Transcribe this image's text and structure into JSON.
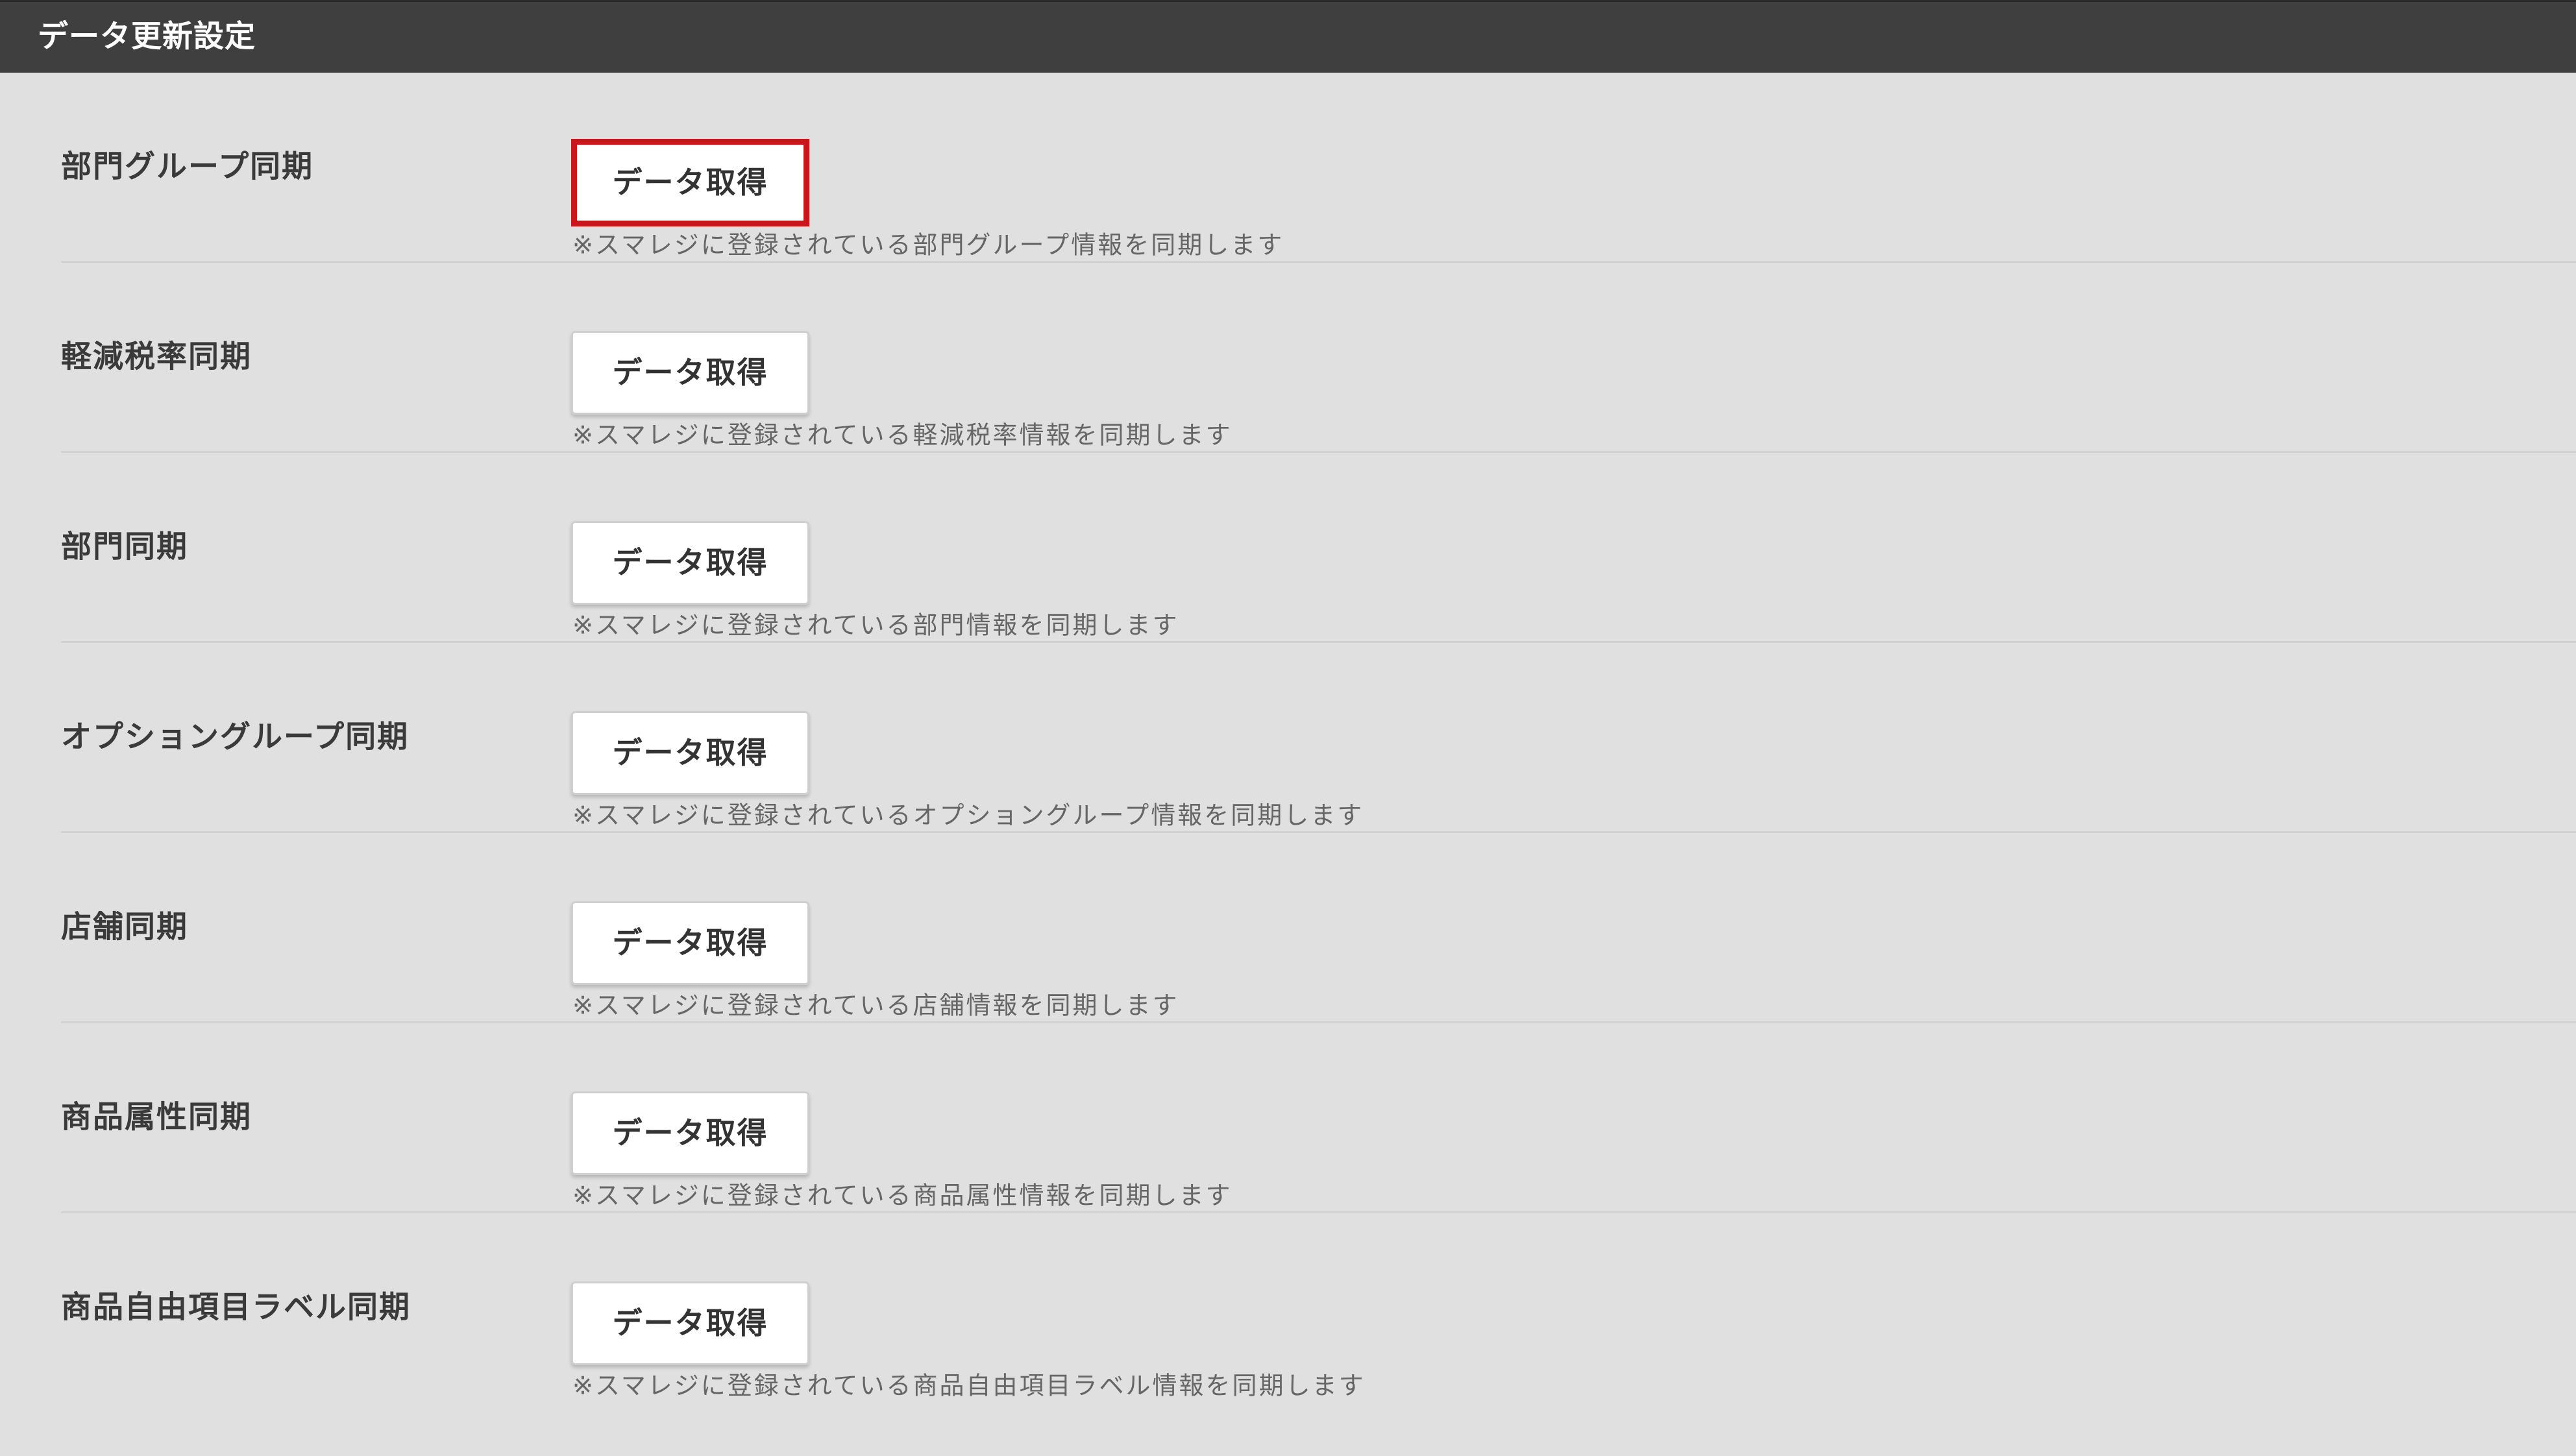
{
  "header": {
    "title": "データ更新設定"
  },
  "rows": [
    {
      "label": "部門グループ同期",
      "button_label": "データ取得",
      "note": "※スマレジに登録されている部門グループ情報を同期します",
      "highlighted": true
    },
    {
      "label": "軽減税率同期",
      "button_label": "データ取得",
      "note": "※スマレジに登録されている軽減税率情報を同期します"
    },
    {
      "label": "部門同期",
      "button_label": "データ取得",
      "note": "※スマレジに登録されている部門情報を同期します"
    },
    {
      "label": "オプショングループ同期",
      "button_label": "データ取得",
      "note": "※スマレジに登録されているオプショングループ情報を同期します"
    },
    {
      "label": "店舗同期",
      "button_label": "データ取得",
      "note": "※スマレジに登録されている店舗情報を同期します"
    },
    {
      "label": "商品属性同期",
      "button_label": "データ取得",
      "note": "※スマレジに登録されている商品属性情報を同期します"
    },
    {
      "label": "商品自由項目ラベル同期",
      "button_label": "データ取得",
      "note": "※スマレジに登録されている商品自由項目ラベル情報を同期します"
    }
  ],
  "colors": {
    "header_bg": "#3f3f3f",
    "page_bg": "#e0e0e0",
    "highlight_border": "#c8161d"
  }
}
